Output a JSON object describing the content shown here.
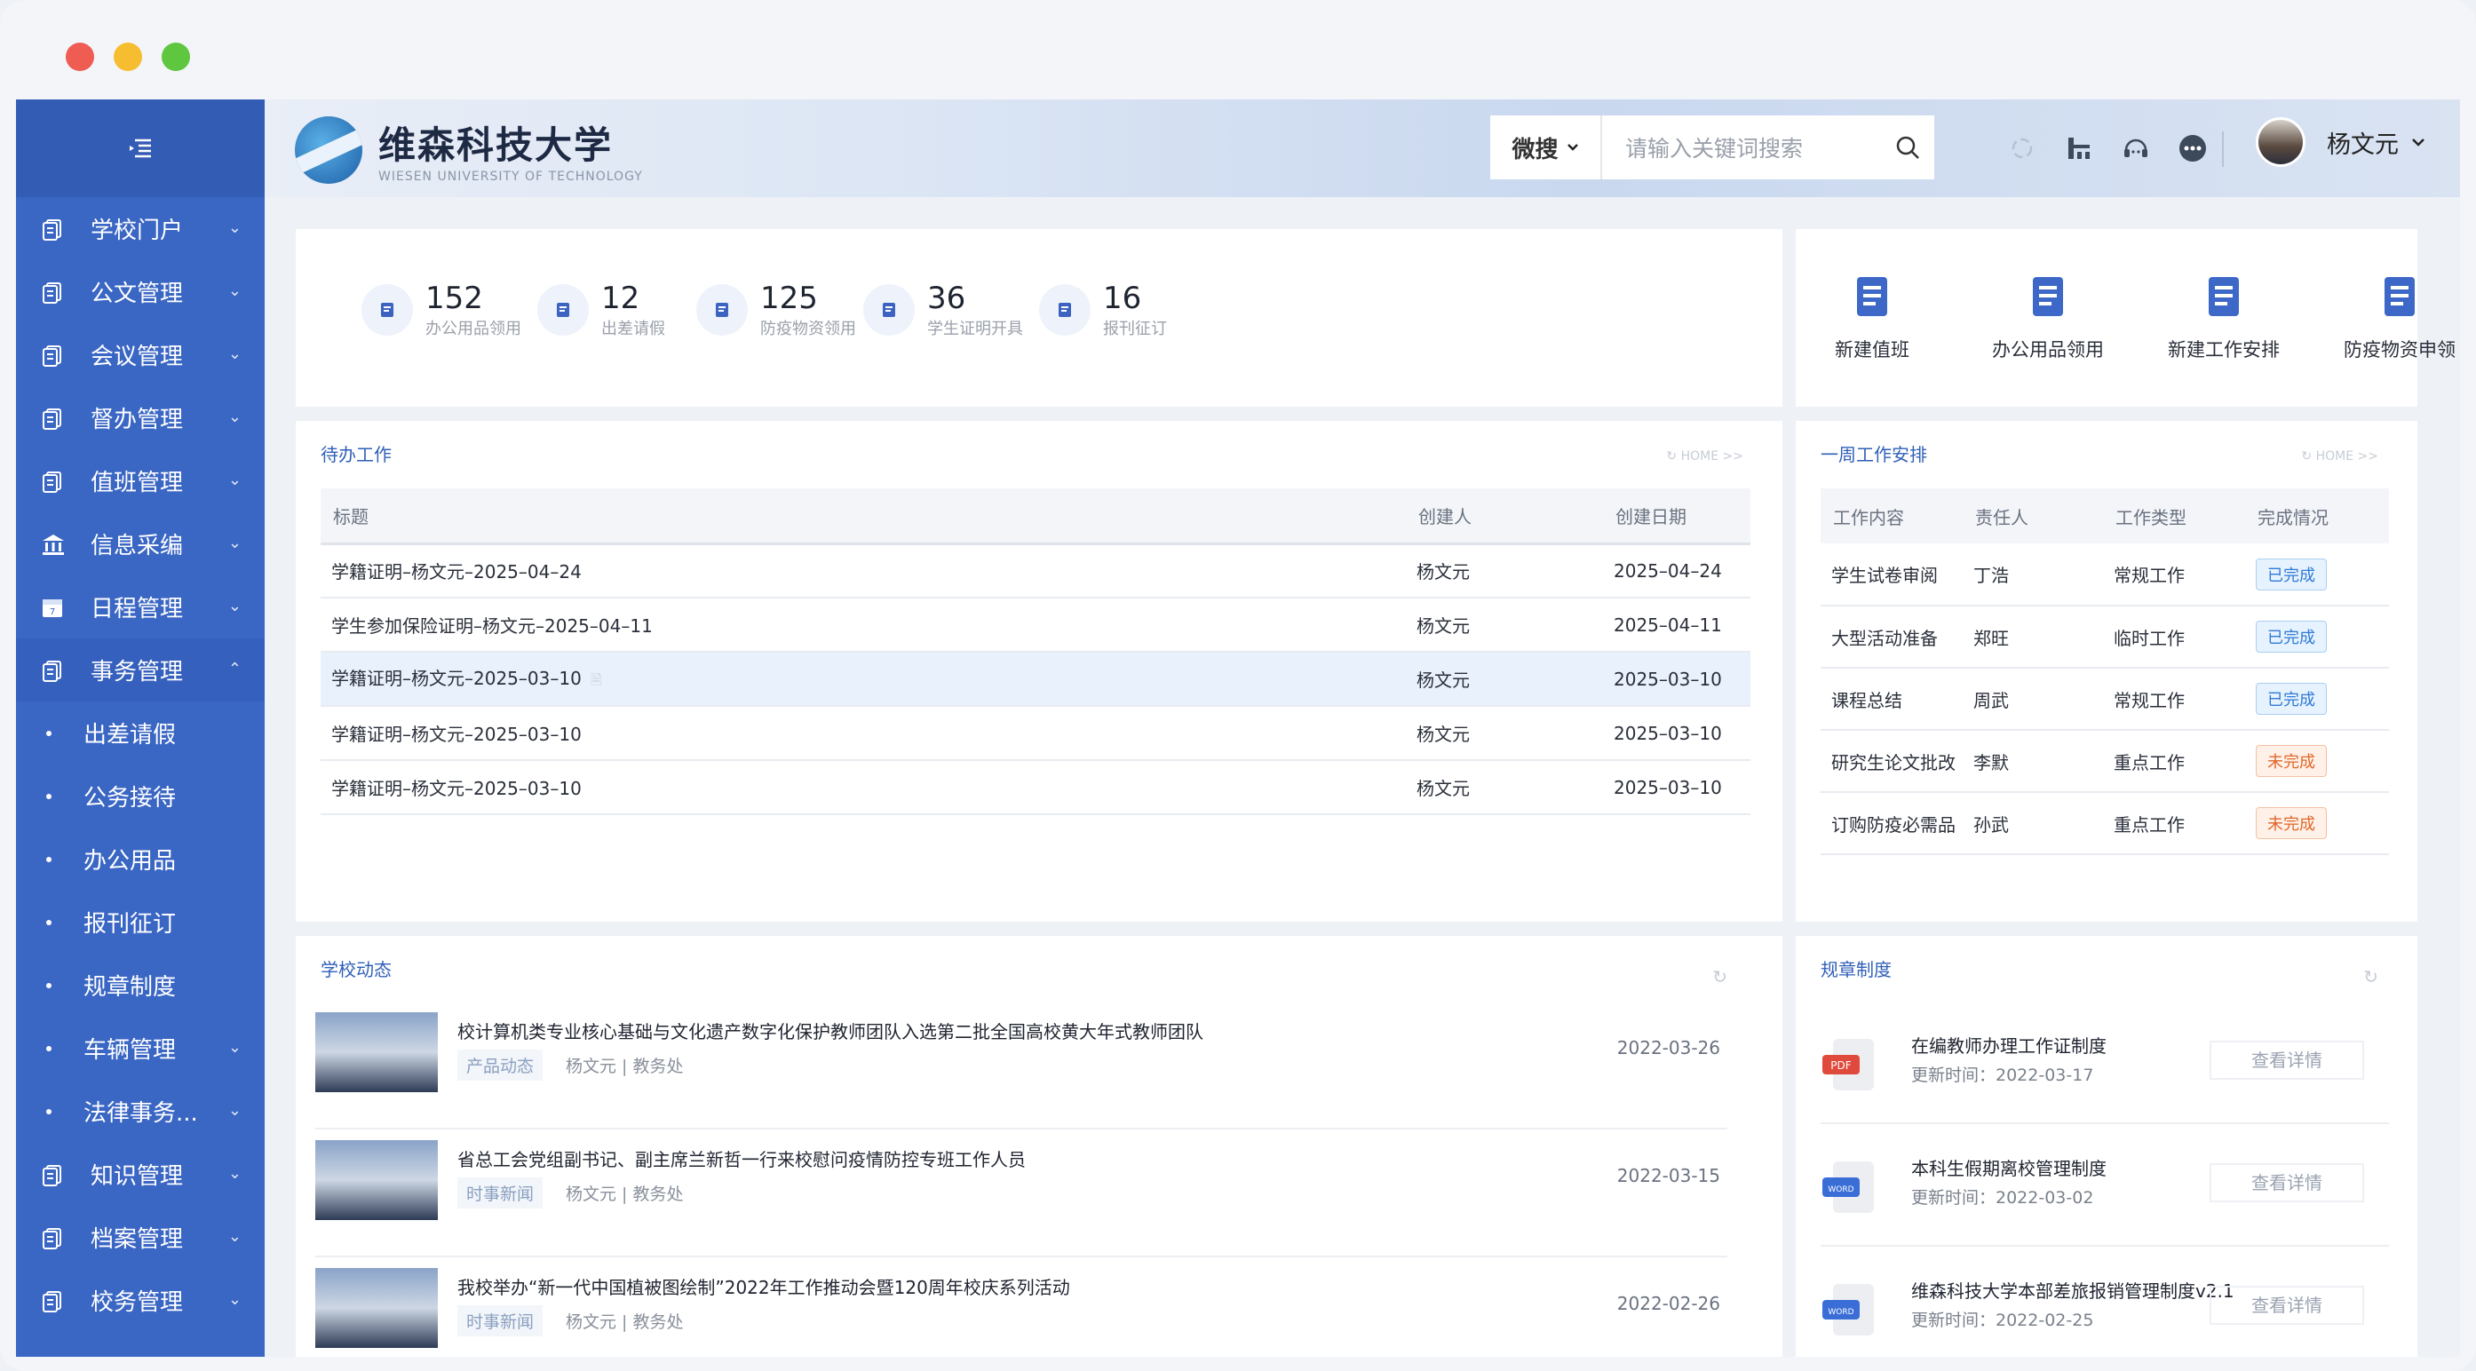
{
  "colors": {
    "sidebar": "#3a66c4",
    "accent": "#2f5fb8",
    "done": "#2f7ad6",
    "undone": "#e0662a"
  },
  "sidebar": {
    "items": [
      {
        "label": "学校门户",
        "icon": "doc-icon",
        "expanded": false
      },
      {
        "label": "公文管理",
        "icon": "doc-icon",
        "expanded": false
      },
      {
        "label": "会议管理",
        "icon": "doc-icon",
        "expanded": false
      },
      {
        "label": "督办管理",
        "icon": "doc-icon",
        "expanded": false
      },
      {
        "label": "值班管理",
        "icon": "doc-icon",
        "expanded": false
      },
      {
        "label": "信息采编",
        "icon": "bank-icon",
        "expanded": false
      },
      {
        "label": "日程管理",
        "icon": "calendar-icon",
        "expanded": false
      },
      {
        "label": "事务管理",
        "icon": "doc-icon",
        "expanded": true
      },
      {
        "label": "知识管理",
        "icon": "doc-icon",
        "expanded": false
      },
      {
        "label": "档案管理",
        "icon": "doc-icon",
        "expanded": false
      },
      {
        "label": "校务管理",
        "icon": "doc-icon",
        "expanded": false
      }
    ],
    "subitems": [
      {
        "label": "出差请假"
      },
      {
        "label": "公务接待"
      },
      {
        "label": "办公用品"
      },
      {
        "label": "报刊征订"
      },
      {
        "label": "规章制度"
      },
      {
        "label": "车辆管理"
      },
      {
        "label": "法律事务..."
      }
    ]
  },
  "header": {
    "logo_cn": "维森科技大学",
    "logo_en": "WIESEN UNIVERSITY OF TECHNOLOGY",
    "search_scope": "微搜",
    "search_placeholder": "请输入关键词搜索",
    "user_name": "杨文元"
  },
  "stats": [
    {
      "value": "152",
      "label": "办公用品领用"
    },
    {
      "value": "12",
      "label": "出差请假"
    },
    {
      "value": "125",
      "label": "防疫物资领用"
    },
    {
      "value": "36",
      "label": "学生证明开具"
    },
    {
      "value": "16",
      "label": "报刊征订"
    }
  ],
  "quick_actions": [
    {
      "label": "新建值班",
      "icon": "list-doc-icon"
    },
    {
      "label": "办公用品领用",
      "icon": "clipboard-check-icon"
    },
    {
      "label": "新建工作安排",
      "icon": "medal-icon"
    },
    {
      "label": "防疫物资申领",
      "icon": "notes-icon"
    }
  ],
  "todo": {
    "title": "待办工作",
    "more": "HOME >>",
    "columns": [
      "标题",
      "创建人",
      "创建日期"
    ],
    "rows": [
      {
        "title": "学籍证明–杨文元–2025–04–24",
        "creator": "杨文元",
        "date": "2025–04–24"
      },
      {
        "title": "学生参加保险证明–杨文元–2025–04–11",
        "creator": "杨文元",
        "date": "2025–04–11"
      },
      {
        "title": "学籍证明–杨文元–2025–03–10",
        "creator": "杨文元",
        "date": "2025–03–10"
      },
      {
        "title": "学籍证明–杨文元–2025–03–10",
        "creator": "杨文元",
        "date": "2025–03–10"
      },
      {
        "title": "学籍证明–杨文元–2025–03–10",
        "creator": "杨文元",
        "date": "2025–03–10"
      }
    ]
  },
  "week": {
    "title": "一周工作安排",
    "more": "HOME >>",
    "columns": [
      "工作内容",
      "责任人",
      "工作类型",
      "完成情况"
    ],
    "rows": [
      {
        "content": "学生试卷审阅",
        "owner": "丁浩",
        "type": "常规工作",
        "status": "已完成"
      },
      {
        "content": "大型活动准备",
        "owner": "郑旺",
        "type": "临时工作",
        "status": "已完成"
      },
      {
        "content": "课程总结",
        "owner": "周武",
        "type": "常规工作",
        "status": "已完成"
      },
      {
        "content": "研究生论文批改",
        "owner": "李默",
        "type": "重点工作",
        "status": "未完成"
      },
      {
        "content": "订购防疫必需品",
        "owner": "孙武",
        "type": "重点工作",
        "status": "未完成"
      }
    ]
  },
  "news": {
    "title": "学校动态",
    "items": [
      {
        "title": "校计算机类专业核心基础与文化遗产数字化保护教师团队入选第二批全国高校黄大年式教师团队",
        "tag": "产品动态",
        "source": "杨文元 | 教务处",
        "date": "2022-03-26"
      },
      {
        "title": "省总工会党组副书记、副主席兰新哲一行来校慰问疫情防控专班工作人员",
        "tag": "时事新闻",
        "source": "杨文元 | 教务处",
        "date": "2022-03-15"
      },
      {
        "title": "我校举办“新一代中国植被图绘制”2022年工作推动会暨120周年校庆系列活动",
        "tag": "时事新闻",
        "source": "杨文元 | 教务处",
        "date": "2022-02-26"
      }
    ]
  },
  "regs": {
    "title": "规章制度",
    "items": [
      {
        "title": "在编教师办理工作证制度",
        "type": "PDF",
        "updated": "更新时间：2022-03-17",
        "action": "查看详情"
      },
      {
        "title": "本科生假期离校管理制度",
        "type": "WORD",
        "updated": "更新时间：2022-03-02",
        "action": "查看详情"
      },
      {
        "title": "维森科技大学本部差旅报销管理制度v2.1",
        "type": "WORD",
        "updated": "更新时间：2022-02-25",
        "action": "查看详情"
      }
    ]
  }
}
